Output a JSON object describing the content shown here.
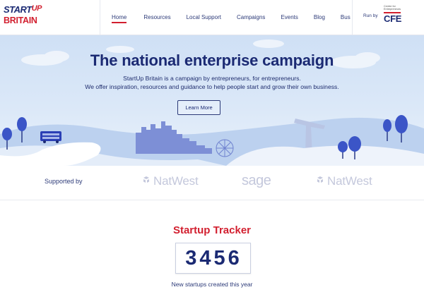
{
  "logo": {
    "line1_start": "START",
    "line1_up": "UP",
    "line2": "BRITAIN"
  },
  "nav": {
    "items": [
      "Home",
      "Resources",
      "Local Support",
      "Campaigns",
      "Events",
      "Blog",
      "Bus"
    ],
    "active": "Home"
  },
  "runby": {
    "label": "Run by",
    "cfe_small_line1": "Centre for",
    "cfe_small_line2": "Entrepreneurs",
    "cfe_big": "CFE"
  },
  "hero": {
    "title": "The national enterprise campaign",
    "subtitle_line1": "StartUp Britain is a campaign by entrepreneurs, for entrepreneurs.",
    "subtitle_line2": "We offer inspiration, resources and guidance to help people start and grow their own business.",
    "button": "Learn More"
  },
  "supported": {
    "label": "Supported by",
    "sponsors": [
      "NatWest",
      "sage",
      "NatWest"
    ]
  },
  "tracker": {
    "title": "Startup Tracker",
    "count": "3456",
    "caption": "New startups created this year"
  },
  "colors": {
    "navy": "#1b2a73",
    "red": "#d21f2f",
    "sky": "#d6e5f7",
    "sponsor_grey": "#c4c8dc"
  }
}
